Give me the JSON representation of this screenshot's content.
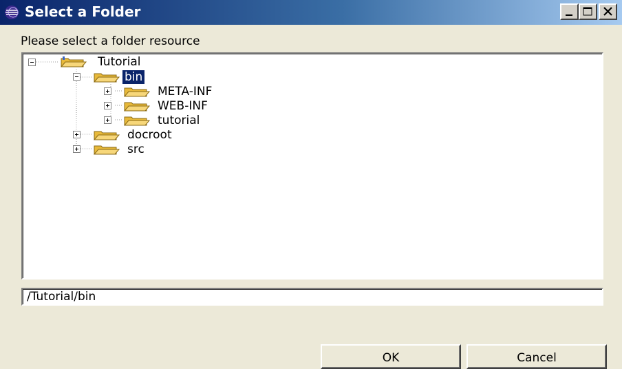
{
  "window": {
    "title": "Select a Folder",
    "controls": {
      "minimize": "minimize-icon",
      "maximize": "maximize-icon",
      "close": "close-icon"
    }
  },
  "prompt": "Please select a folder resource",
  "tree": {
    "nodes": [
      {
        "label": "Tutorial",
        "state": "expanded",
        "icon": "open-folder-icon"
      },
      {
        "label": "bin",
        "state": "expanded",
        "selected": true,
        "icon": "open-folder-icon"
      },
      {
        "label": "META-INF",
        "state": "collapsed",
        "icon": "folder-icon"
      },
      {
        "label": "WEB-INF",
        "state": "collapsed",
        "icon": "folder-icon"
      },
      {
        "label": "tutorial",
        "state": "collapsed",
        "icon": "folder-icon"
      },
      {
        "label": "docroot",
        "state": "collapsed",
        "icon": "folder-icon"
      },
      {
        "label": "src",
        "state": "collapsed",
        "icon": "folder-icon"
      }
    ]
  },
  "path_field": {
    "value": "/Tutorial/bin"
  },
  "buttons": {
    "ok": "OK",
    "cancel": "Cancel"
  },
  "colors": {
    "title_gradient_start": "#0a246a",
    "title_gradient_end": "#a6caf0",
    "selection": "#0a246a",
    "dialog_background": "#ece9d8",
    "folder_fill": "#f2c94c"
  }
}
